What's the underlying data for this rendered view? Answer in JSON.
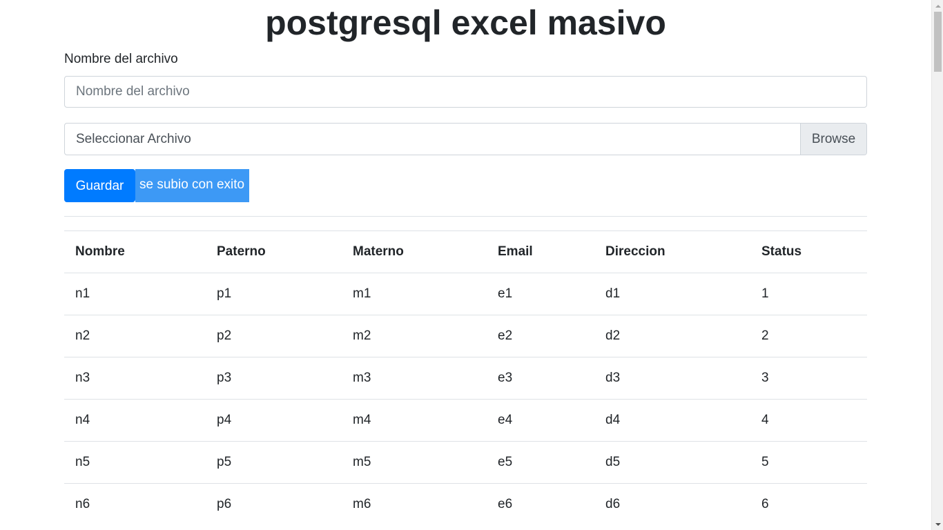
{
  "page": {
    "title": "postgresql excel masivo"
  },
  "form": {
    "filename_label": "Nombre del archivo",
    "filename_placeholder": "Nombre del archivo",
    "filename_value": "",
    "file_label": "Seleccionar Archivo",
    "browse_label": "Browse",
    "save_label": "Guardar",
    "status_message": "se subio con exito"
  },
  "table": {
    "headers": [
      "Nombre",
      "Paterno",
      "Materno",
      "Email",
      "Direccion",
      "Status"
    ],
    "rows": [
      [
        "n1",
        "p1",
        "m1",
        "e1",
        "d1",
        "1"
      ],
      [
        "n2",
        "p2",
        "m2",
        "e2",
        "d2",
        "2"
      ],
      [
        "n3",
        "p3",
        "m3",
        "e3",
        "d3",
        "3"
      ],
      [
        "n4",
        "p4",
        "m4",
        "e4",
        "d4",
        "4"
      ],
      [
        "n5",
        "p5",
        "m5",
        "e5",
        "d5",
        "5"
      ],
      [
        "n6",
        "p6",
        "m6",
        "e6",
        "d6",
        "6"
      ]
    ]
  },
  "colors": {
    "primary": "#007bff",
    "status_background": "#3d99f5",
    "border": "#dee2e6"
  }
}
